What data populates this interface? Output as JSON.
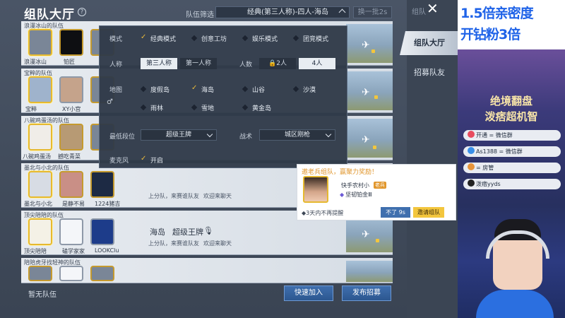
{
  "hall": {
    "title": "组队大厅",
    "filter_label": "队伍筛选",
    "filter_value": "经典(第三人称)-四人-海岛",
    "refresh_label": "换一批2s"
  },
  "side": {
    "menu_shadow": "组队",
    "tabs": [
      {
        "label": "组队大厅"
      },
      {
        "label": "招募队友"
      }
    ]
  },
  "teams": [
    {
      "name": "浪漫冰山的队伍",
      "members": [
        "浪漫冰山",
        "",
        "铂匠"
      ]
    },
    {
      "name": "宝粹的队伍",
      "members": [
        "宝粹",
        "XY小宫",
        ""
      ]
    },
    {
      "name": "八碗鸡蛋汤的队伍",
      "members": [
        "八碗鸡蛋汤",
        "撼吃青菜",
        ""
      ]
    },
    {
      "name": "墨北与小北的队伍",
      "members": [
        "墨北与小北",
        "是静不易",
        "1224猪吉"
      ],
      "info": "上分队，来赛谁队友",
      "welcome": "欢迎来聊天"
    },
    {
      "name": "顶尖陪陪的队伍",
      "members": [
        "顶尖陪陪",
        "磕学家家",
        "LOOKClu"
      ],
      "map": "海岛",
      "rank": "超级王牌",
      "info": "上分队，来赛谁队友",
      "welcome": "欢迎来聊天"
    },
    {
      "name": "陪陪虎牙找轻神的队伍",
      "members": [
        "",
        "",
        ""
      ]
    }
  ],
  "no_team_label": "暂无队伍",
  "quick_join_label": "快速加入",
  "post_recruit_label": "发布招募",
  "filter": {
    "mode_label": "模式",
    "modes": [
      {
        "label": "经典模式",
        "on": true
      },
      {
        "label": "创意工坊",
        "on": false
      },
      {
        "label": "娱乐模式",
        "on": false
      },
      {
        "label": "团竞模式",
        "on": false
      }
    ],
    "view_label": "人称",
    "views": [
      {
        "label": "第三人称",
        "on": true
      },
      {
        "label": "第一人称",
        "on": false
      }
    ],
    "size_label": "人数",
    "sizes": [
      {
        "label": "2人",
        "on": false,
        "locked": true
      },
      {
        "label": "4人",
        "on": true
      }
    ],
    "map_label": "地图",
    "maps": [
      {
        "label": "度假岛",
        "on": false
      },
      {
        "label": "海岛",
        "on": true
      },
      {
        "label": "山谷",
        "on": false
      },
      {
        "label": "沙漠",
        "on": false
      },
      {
        "label": "雨林",
        "on": false
      },
      {
        "label": "雪地",
        "on": false
      },
      {
        "label": "黄金岛",
        "on": false
      }
    ],
    "min_rank_label": "最低段位",
    "min_rank_value": "超级王牌",
    "tactic_label": "战术",
    "tactic_value": "城区刚枪",
    "mic_label": "麦克风",
    "mic_value": "开启"
  },
  "invite": {
    "header": "邀老兵组队，赢聚力奖励！",
    "name": "快手农村小",
    "badge": "老兵",
    "rank": "坚韧铂金Ⅲ",
    "dont_remind": "3天内不再提醒",
    "decline_label": "不了 9s",
    "invite_label": "邀请组队"
  },
  "stream": {
    "promo_line1": "1.5倍亲密度",
    "promo_line2": "开钻粉3倍",
    "poster_title1": "绝境翻盘",
    "poster_title2": "泼痞超机智",
    "chips": [
      {
        "text": "开通 = 微信群",
        "color": "#e84b5e"
      },
      {
        "text": "As1388 = 微信群",
        "color": "#3a8fe8"
      },
      {
        "text": "= 房管",
        "color": "#e8943a"
      },
      {
        "text": "泼痞yyds",
        "color": "#222222"
      }
    ]
  }
}
